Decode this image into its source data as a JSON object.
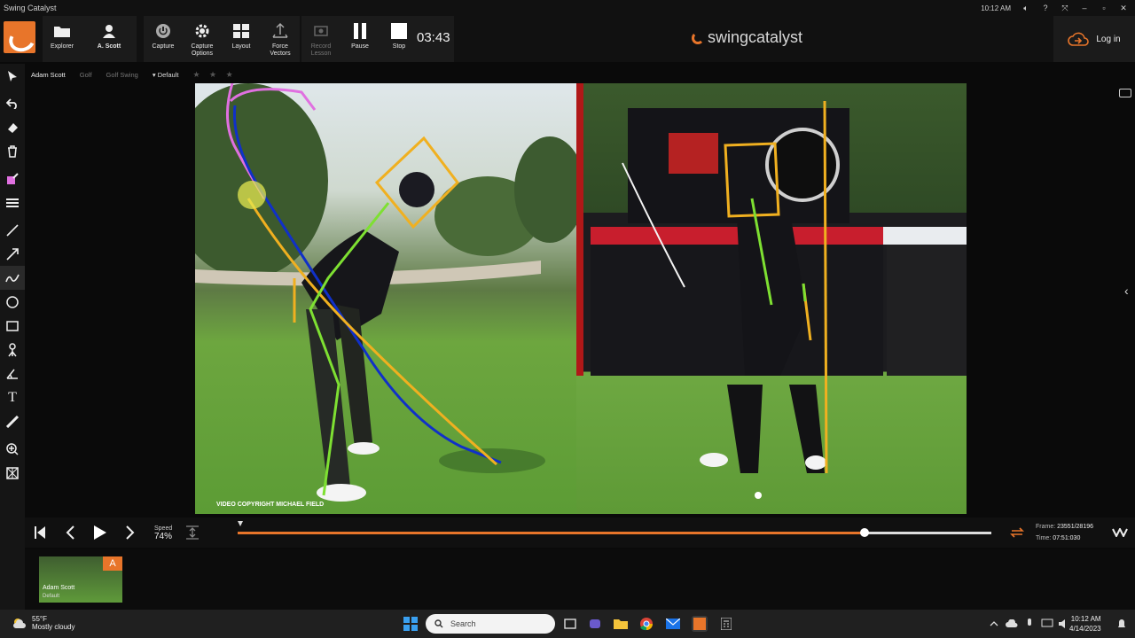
{
  "window": {
    "title": "Swing Catalyst",
    "clock": "10:12 AM",
    "help": "?"
  },
  "toolbar": {
    "explorer": "Explorer",
    "user": "A. Scott",
    "capture": "Capture",
    "capture_options": "Capture\nOptions",
    "layout": "Layout",
    "force_vectors": "Force\nVectors",
    "record_lesson": "Record\nLesson",
    "pause": "Pause",
    "stop": "Stop",
    "timer": "03:43",
    "brand": "swingcatalyst",
    "login": "Log in"
  },
  "breadcrumb": {
    "player": "Adam Scott",
    "sport": "Golf",
    "category": "Golf Swing",
    "layout": "Default",
    "rating_stars": "★ ★ ★"
  },
  "video": {
    "copyright": "VIDEO COPYRIGHT MICHAEL FIELD"
  },
  "transport": {
    "speed_label": "Speed",
    "speed_value": "74%",
    "progress": 0.832,
    "frame_label": "Frame:",
    "frame_value": "23551/28196",
    "time_label": "Time:",
    "time_value": "07:51:030"
  },
  "thumbnail": {
    "name": "Adam Scott",
    "sub": "Default",
    "badge": "A"
  },
  "taskbar": {
    "temp": "55°F",
    "weather": "Mostly cloudy",
    "search_placeholder": "Search",
    "time": "10:12 AM",
    "date": "4/14/2023"
  },
  "colors": {
    "accent": "#e8752a",
    "draw_yellow": "#f0b020",
    "draw_green": "#7ee032",
    "draw_blue": "#1030c8",
    "draw_pink": "#e070e0"
  }
}
